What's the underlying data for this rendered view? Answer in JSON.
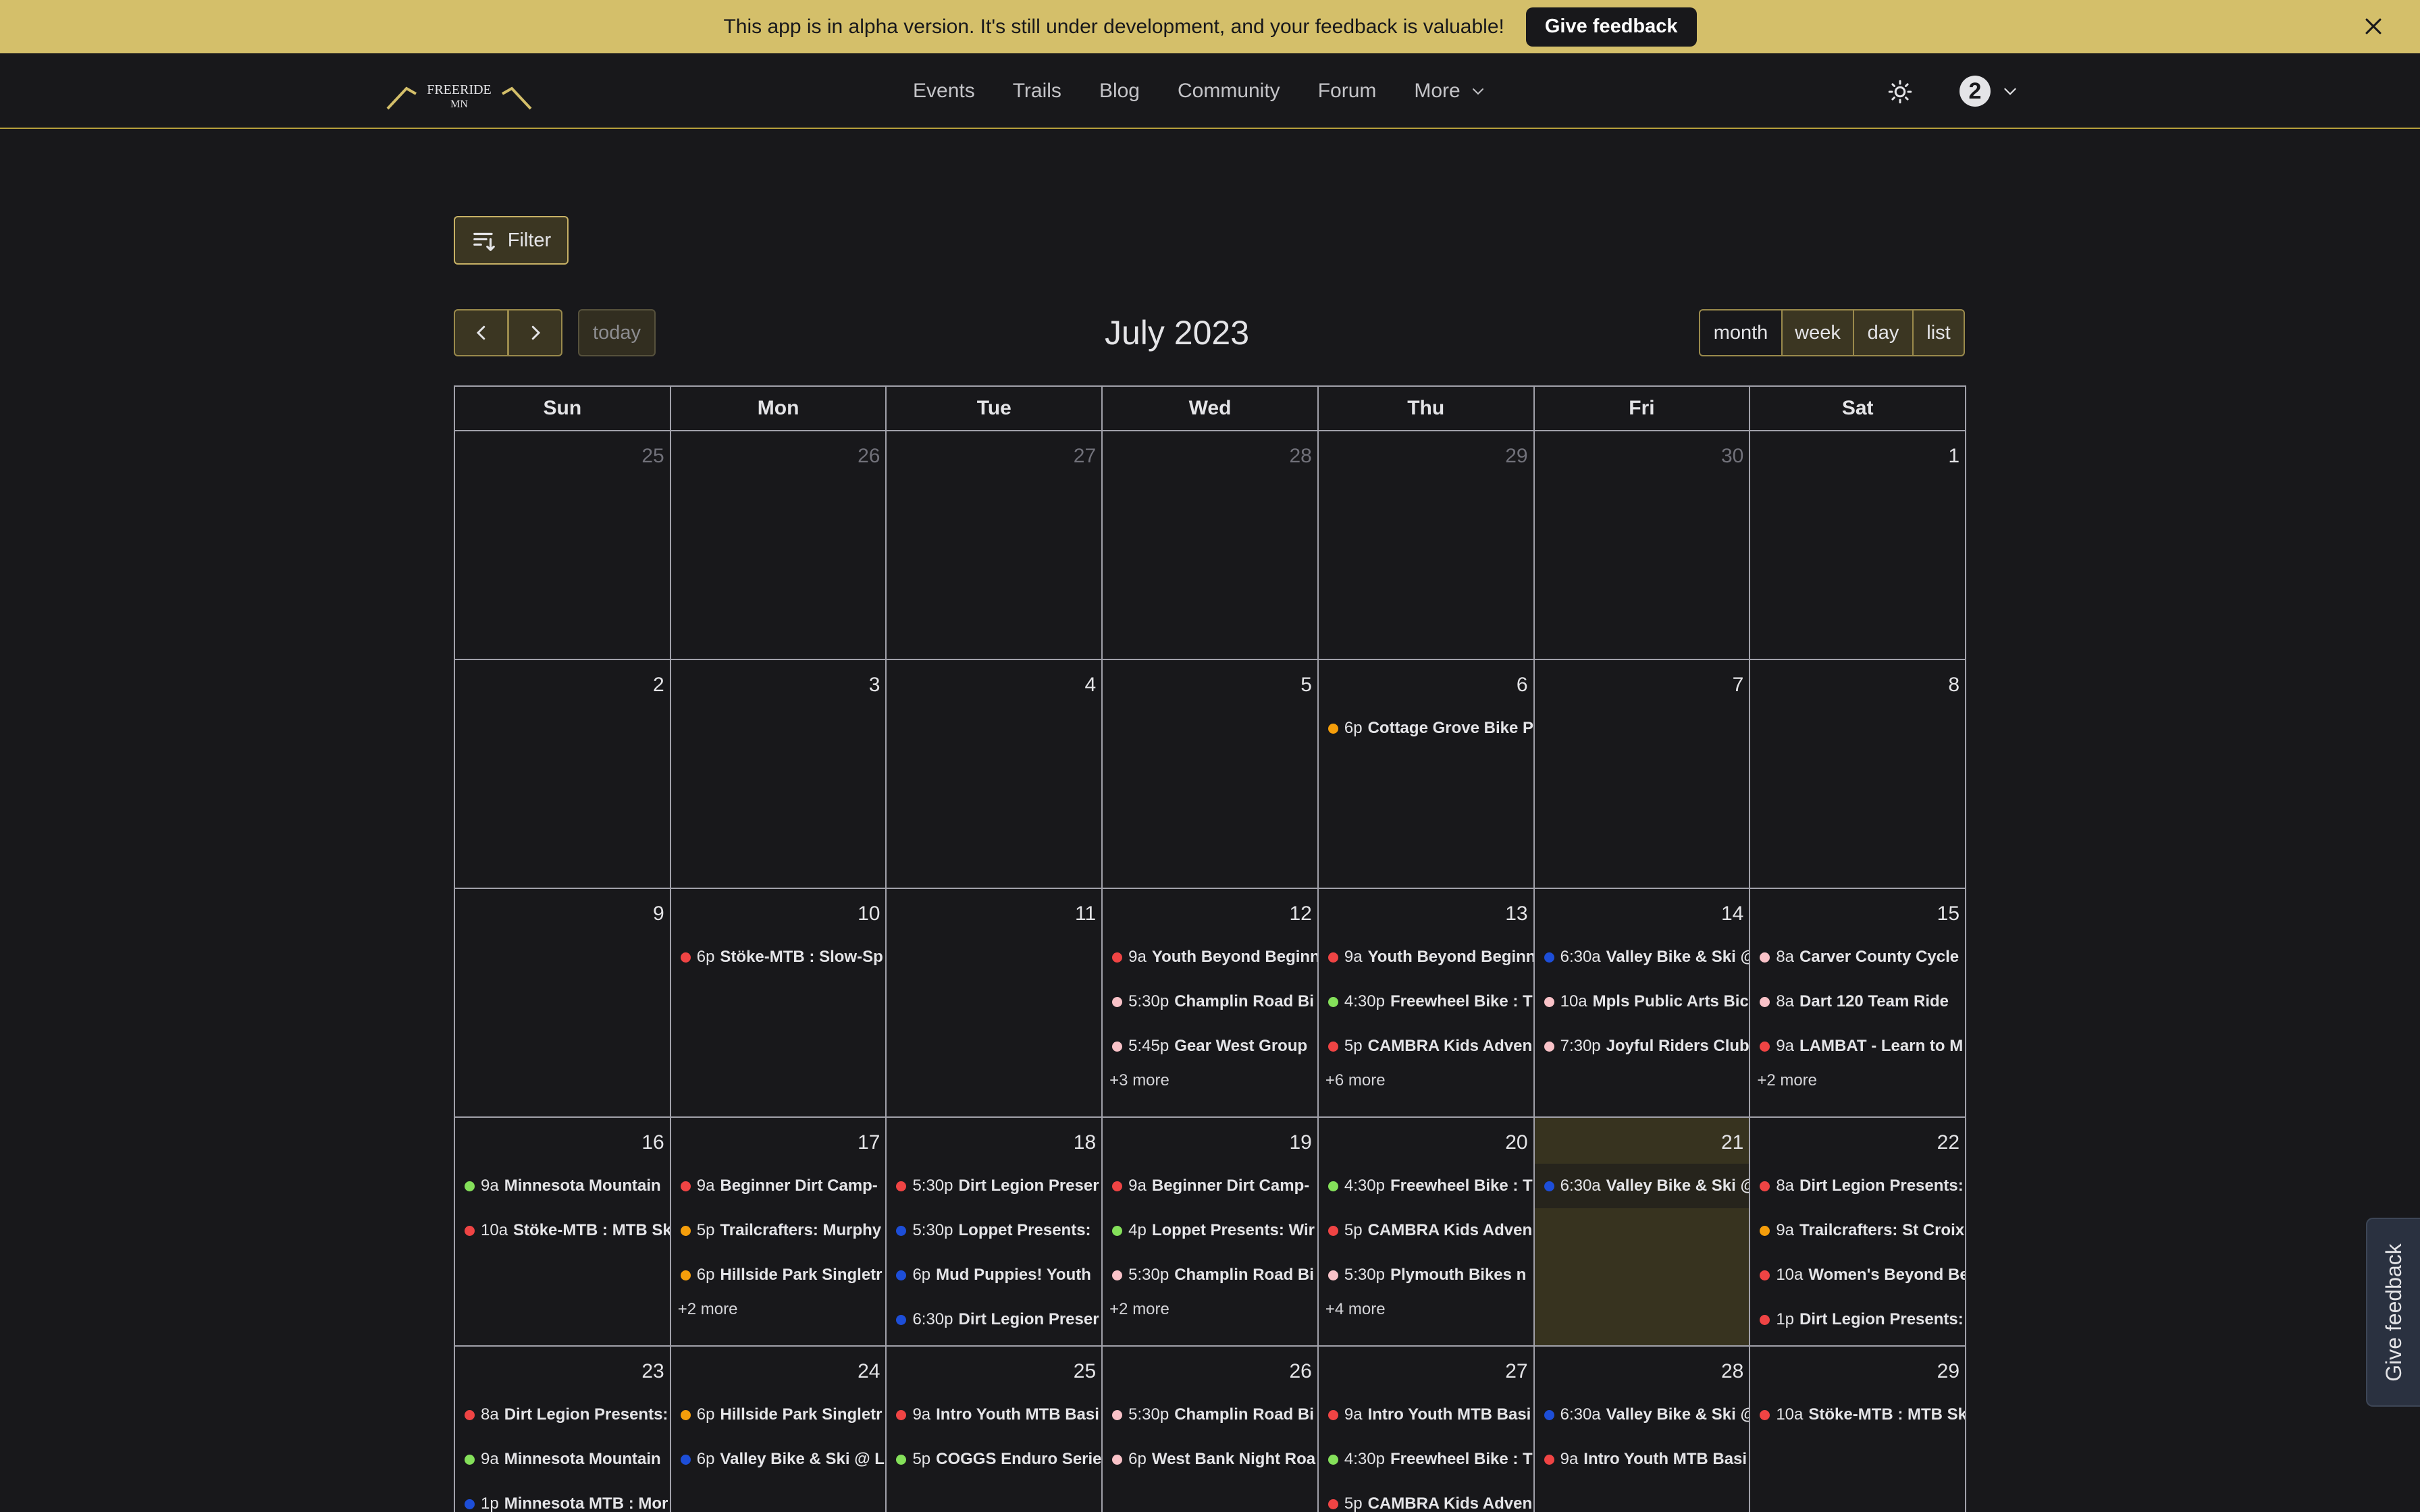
{
  "banner": {
    "message": "This app is in alpha version. It's still under development, and your feedback is valuable!",
    "button_label": "Give feedback"
  },
  "logo": {
    "line1": "FREERIDE",
    "line2": "MN"
  },
  "nav": [
    "Events",
    "Trails",
    "Blog",
    "Community",
    "Forum",
    "More"
  ],
  "user": {
    "avatar_label": "2"
  },
  "toolbar": {
    "filter_label": "Filter",
    "today_label": "today",
    "title": "July 2023",
    "views": [
      "month",
      "week",
      "day",
      "list"
    ],
    "active_view": "month"
  },
  "weekdays": [
    "Sun",
    "Mon",
    "Tue",
    "Wed",
    "Thu",
    "Fri",
    "Sat"
  ],
  "colors": {
    "red": "#ef4444",
    "orange": "#f59e0b",
    "blue": "#1d4ed8",
    "green": "#84e05a",
    "pink": "#f9c2c8",
    "accent": "#d4bf6a"
  },
  "weeks": [
    [
      {
        "day": "25",
        "other": true,
        "events": [],
        "more": ""
      },
      {
        "day": "26",
        "other": true,
        "events": [],
        "more": ""
      },
      {
        "day": "27",
        "other": true,
        "events": [],
        "more": ""
      },
      {
        "day": "28",
        "other": true,
        "events": [],
        "more": ""
      },
      {
        "day": "29",
        "other": true,
        "events": [],
        "more": ""
      },
      {
        "day": "30",
        "other": true,
        "events": [],
        "more": ""
      },
      {
        "day": "1",
        "events": [],
        "more": ""
      }
    ],
    [
      {
        "day": "2",
        "events": [],
        "more": ""
      },
      {
        "day": "3",
        "events": [],
        "more": ""
      },
      {
        "day": "4",
        "events": [],
        "more": ""
      },
      {
        "day": "5",
        "events": [],
        "more": ""
      },
      {
        "day": "6",
        "events": [
          {
            "color": "orange",
            "time": "6p",
            "title": "Cottage Grove Bike P"
          }
        ],
        "more": ""
      },
      {
        "day": "7",
        "events": [],
        "more": ""
      },
      {
        "day": "8",
        "events": [],
        "more": ""
      }
    ],
    [
      {
        "day": "9",
        "events": [],
        "more": ""
      },
      {
        "day": "10",
        "events": [
          {
            "color": "red",
            "time": "6p",
            "title": "Stöke-MTB : Slow-Sp"
          }
        ],
        "more": ""
      },
      {
        "day": "11",
        "events": [],
        "more": ""
      },
      {
        "day": "12",
        "events": [
          {
            "color": "red",
            "time": "9a",
            "title": "Youth Beyond Beginn"
          },
          {
            "color": "pink",
            "time": "5:30p",
            "title": "Champlin Road Bi"
          },
          {
            "color": "pink",
            "time": "5:45p",
            "title": "Gear West Group"
          }
        ],
        "more": "+3 more"
      },
      {
        "day": "13",
        "events": [
          {
            "color": "red",
            "time": "9a",
            "title": "Youth Beyond Beginn"
          },
          {
            "color": "green",
            "time": "4:30p",
            "title": "Freewheel Bike : T"
          },
          {
            "color": "red",
            "time": "5p",
            "title": "CAMBRA Kids Adven"
          }
        ],
        "more": "+6 more"
      },
      {
        "day": "14",
        "events": [
          {
            "color": "blue",
            "time": "6:30a",
            "title": "Valley Bike & Ski @"
          },
          {
            "color": "pink",
            "time": "10a",
            "title": "Mpls Public Arts Bic"
          },
          {
            "color": "pink",
            "time": "7:30p",
            "title": "Joyful Riders Club"
          }
        ],
        "more": ""
      },
      {
        "day": "15",
        "events": [
          {
            "color": "pink",
            "time": "8a",
            "title": "Carver County Cycle"
          },
          {
            "color": "pink",
            "time": "8a",
            "title": "Dart 120 Team Ride"
          },
          {
            "color": "red",
            "time": "9a",
            "title": "LAMBAT - Learn to M"
          }
        ],
        "more": "+2 more"
      }
    ],
    [
      {
        "day": "16",
        "events": [
          {
            "color": "green",
            "time": "9a",
            "title": "Minnesota Mountain"
          },
          {
            "color": "red",
            "time": "10a",
            "title": "Stöke-MTB : MTB Sk"
          }
        ],
        "more": ""
      },
      {
        "day": "17",
        "events": [
          {
            "color": "red",
            "time": "9a",
            "title": "Beginner Dirt Camp-"
          },
          {
            "color": "orange",
            "time": "5p",
            "title": "Trailcrafters: Murphy"
          },
          {
            "color": "orange",
            "time": "6p",
            "title": "Hillside Park Singletr"
          }
        ],
        "more": "+2 more"
      },
      {
        "day": "18",
        "events": [
          {
            "color": "red",
            "time": "5:30p",
            "title": "Dirt Legion Preser"
          },
          {
            "color": "blue",
            "time": "5:30p",
            "title": "Loppet Presents:"
          },
          {
            "color": "blue",
            "time": "6p",
            "title": "Mud Puppies! Youth"
          },
          {
            "color": "blue",
            "time": "6:30p",
            "title": "Dirt Legion Preser"
          }
        ],
        "more": ""
      },
      {
        "day": "19",
        "events": [
          {
            "color": "red",
            "time": "9a",
            "title": "Beginner Dirt Camp-"
          },
          {
            "color": "green",
            "time": "4p",
            "title": "Loppet Presents: Wir"
          },
          {
            "color": "pink",
            "time": "5:30p",
            "title": "Champlin Road Bi"
          }
        ],
        "more": "+2 more"
      },
      {
        "day": "20",
        "events": [
          {
            "color": "green",
            "time": "4:30p",
            "title": "Freewheel Bike : T"
          },
          {
            "color": "red",
            "time": "5p",
            "title": "CAMBRA Kids Adven"
          },
          {
            "color": "pink",
            "time": "5:30p",
            "title": "Plymouth Bikes n"
          }
        ],
        "more": "+4 more"
      },
      {
        "day": "21",
        "today": true,
        "events": [
          {
            "color": "blue",
            "time": "6:30a",
            "title": "Valley Bike & Ski @"
          }
        ],
        "more": ""
      },
      {
        "day": "22",
        "events": [
          {
            "color": "red",
            "time": "8a",
            "title": "Dirt Legion Presents:"
          },
          {
            "color": "orange",
            "time": "9a",
            "title": "Trailcrafters: St Croix"
          },
          {
            "color": "red",
            "time": "10a",
            "title": "Women's Beyond Be"
          },
          {
            "color": "red",
            "time": "1p",
            "title": "Dirt Legion Presents:"
          }
        ],
        "more": ""
      }
    ],
    [
      {
        "day": "23",
        "events": [
          {
            "color": "red",
            "time": "8a",
            "title": "Dirt Legion Presents:"
          },
          {
            "color": "green",
            "time": "9a",
            "title": "Minnesota Mountain"
          },
          {
            "color": "blue",
            "time": "1p",
            "title": "Minnesota MTB : Mor"
          }
        ],
        "more": ""
      },
      {
        "day": "24",
        "events": [
          {
            "color": "orange",
            "time": "6p",
            "title": "Hillside Park Singletr"
          },
          {
            "color": "blue",
            "time": "6p",
            "title": "Valley Bike & Ski @ Lo"
          }
        ],
        "more": ""
      },
      {
        "day": "25",
        "events": [
          {
            "color": "red",
            "time": "9a",
            "title": "Intro Youth MTB Basi"
          },
          {
            "color": "green",
            "time": "5p",
            "title": "COGGS Enduro Serie"
          }
        ],
        "more": ""
      },
      {
        "day": "26",
        "events": [
          {
            "color": "pink",
            "time": "5:30p",
            "title": "Champlin Road Bi"
          },
          {
            "color": "pink",
            "time": "6p",
            "title": "West Bank Night Roa"
          }
        ],
        "more": ""
      },
      {
        "day": "27",
        "events": [
          {
            "color": "red",
            "time": "9a",
            "title": "Intro Youth MTB Basi"
          },
          {
            "color": "green",
            "time": "4:30p",
            "title": "Freewheel Bike : T"
          },
          {
            "color": "red",
            "time": "5p",
            "title": "CAMBRA Kids Adven"
          }
        ],
        "more": ""
      },
      {
        "day": "28",
        "events": [
          {
            "color": "blue",
            "time": "6:30a",
            "title": "Valley Bike & Ski @"
          },
          {
            "color": "red",
            "time": "9a",
            "title": "Intro Youth MTB Basi"
          }
        ],
        "more": ""
      },
      {
        "day": "29",
        "events": [
          {
            "color": "red",
            "time": "10a",
            "title": "Stöke-MTB : MTB Sk"
          }
        ],
        "more": ""
      }
    ]
  ],
  "side_feedback_label": "Give feedback"
}
